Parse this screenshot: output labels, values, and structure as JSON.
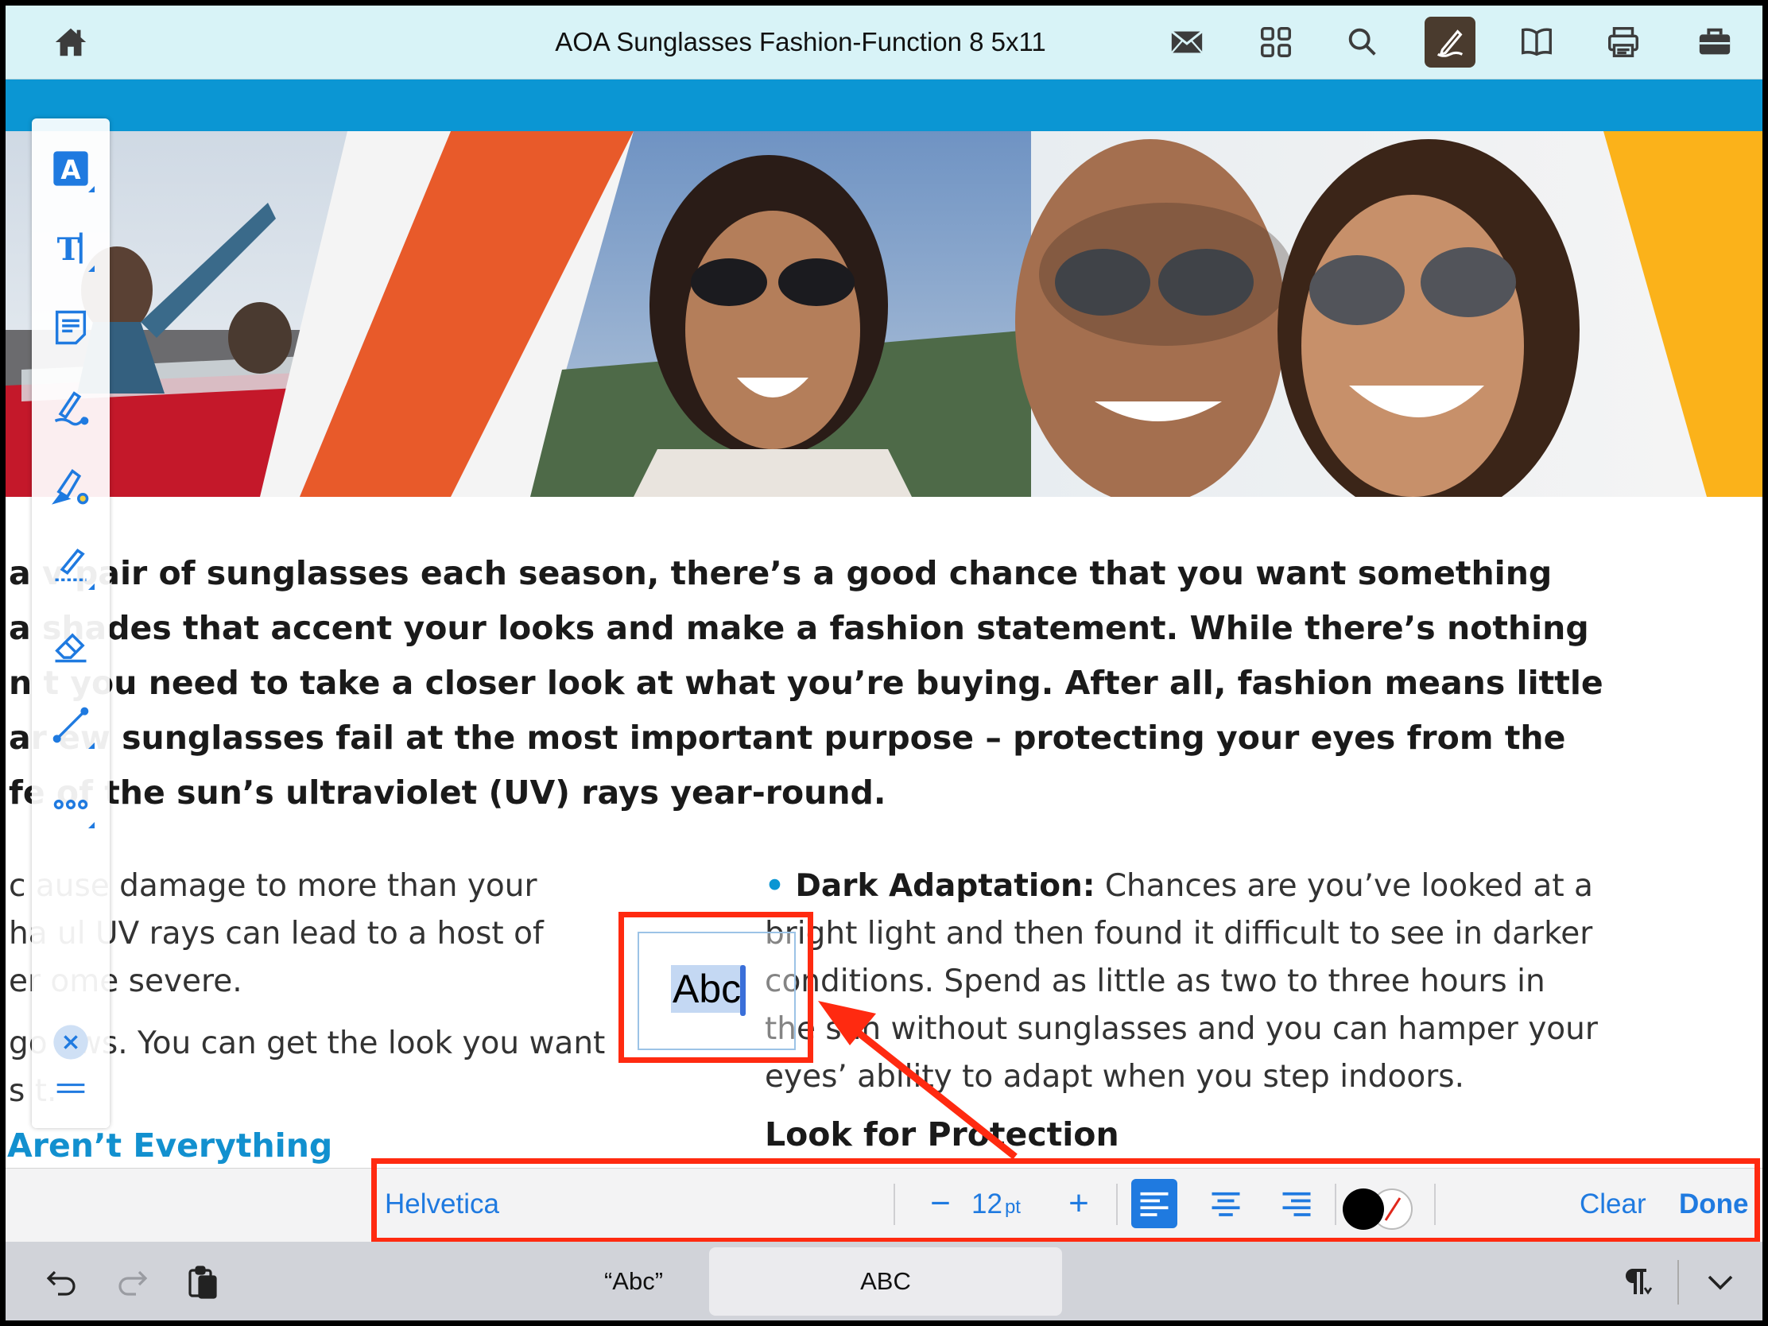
{
  "topbar": {
    "title": "AOA Sunglasses Fashion-Function 8 5x11",
    "icons": [
      "home-icon",
      "mail-icon",
      "grid-icon",
      "search-icon",
      "annotate-icon",
      "book-icon",
      "print-icon",
      "briefcase-icon"
    ]
  },
  "document": {
    "intro_lines": [
      "a    v pair of sunglasses each season, there’s a good chance that you want something",
      "a     shades that accent your looks and make a fashion statement. While there’s nothing",
      "n t    you need to take a closer look at what you’re buying. After all, fashion means little",
      "ar    ew sunglasses fail at the most important purpose – protecting your eyes from the",
      "fe    of the sun’s ultraviolet (UV) rays year-round."
    ],
    "left_paragraph_1": [
      "c     ause damage to more than your",
      "ha     ul UV rays can lead to a host of",
      "er     ome severe."
    ],
    "left_paragraph_2": [
      "go     ews. You can get the look you want",
      "s      t."
    ],
    "left_heading": "Aren’t Everything",
    "right_bullet_term": "Dark Adaptation:",
    "right_bullet_first": " Chances are you’ve looked at a",
    "right_bullet_lines": [
      "bright light and then found it difficult to see in darker",
      "conditions. Spend as little as two to three hours in",
      "the sun without sunglasses and you can hamper your",
      "eyes’ ability to adapt when you step indoors."
    ],
    "right_heading": "Look for Protection"
  },
  "annotation_tools": [
    "text-style-icon",
    "text-insert-icon",
    "note-icon",
    "pen-icon",
    "highlighter-icon",
    "pen-ruler-icon",
    "eraser-icon",
    "line-icon",
    "more-icon",
    "close-icon",
    "handle-icon"
  ],
  "textbox": {
    "text": "Abc"
  },
  "format_bar": {
    "font": "Helvetica",
    "minus": "−",
    "size": "12",
    "size_unit": "pt",
    "plus": "+",
    "clear": "Clear",
    "done": "Done",
    "accent_color": "#1f7ae0"
  },
  "keyboard_bar": {
    "suggestion_quoted": "“Abc”",
    "suggestion_caps": "ABC"
  },
  "colors": {
    "highlight_red": "#ff2a10",
    "band_blue": "#0b96d3",
    "topbar_bg": "#d8f3f7"
  }
}
